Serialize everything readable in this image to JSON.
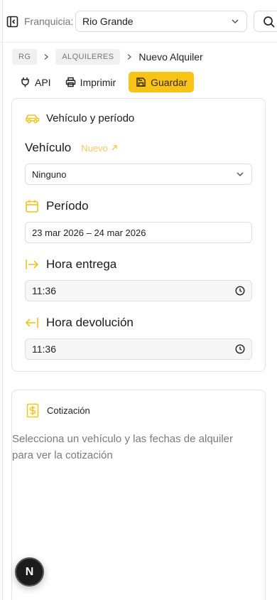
{
  "topbar": {
    "franchise_label": "Franquicia:",
    "franchise_value": "Rio Grande"
  },
  "breadcrumb": {
    "root": "RG",
    "section": "ALQUILERES",
    "current": "Nuevo Alquiler"
  },
  "actions": {
    "api": "API",
    "print": "Imprimir",
    "save": "Guardar"
  },
  "vehicle_card": {
    "title": "Vehículo y período",
    "vehicle_label": "Vehículo",
    "new_link": "Nuevo",
    "vehicle_value": "Ninguno",
    "period_label": "Período",
    "period_value": "23 mar 2026 – 24 mar 2026",
    "delivery_label": "Hora entrega",
    "delivery_value": "11:36",
    "return_label": "Hora devolución",
    "return_value": "11:36"
  },
  "quote_card": {
    "title": "Cotización",
    "empty_text": "Selecciona un vehículo y las fechas de alquiler para ver la cotización"
  },
  "fab": {
    "label": "N"
  },
  "colors": {
    "accent": "#f6c316",
    "accent_text": "#3a2b00",
    "link": "#f2cc55",
    "muted": "#7a7a7a"
  },
  "icons": {
    "sidebar_toggle": "panel-left-icon",
    "search": "search-icon",
    "api": "plug-icon",
    "print": "printer-icon",
    "save": "save-icon",
    "vehicle": "car-icon",
    "period": "calendar-icon",
    "delivery": "arrow-right-to-line-icon",
    "return": "arrow-left-to-line-icon",
    "quote": "dollar-receipt-icon",
    "clock": "clock-icon"
  }
}
